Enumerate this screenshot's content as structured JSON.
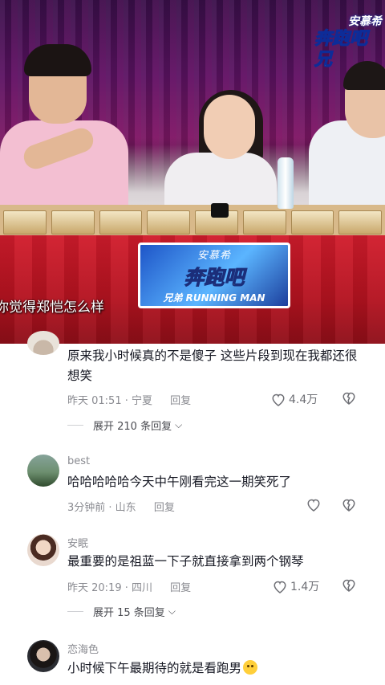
{
  "video": {
    "caption": "你觉得郑恺怎么样",
    "brand_sign": {
      "line1": "安慕希",
      "line2": "奔跑吧",
      "line3": "兄弟 RUNNING MAN"
    },
    "corner_logo": {
      "line1": "安慕希",
      "line2": "奔跑吧兄"
    }
  },
  "comments": [
    {
      "text": "原来我小时候真的不是傻子 这些片段到现在我都还很想笑",
      "time_location": "昨天 01:51 · 宁夏",
      "reply_label": "回复",
      "like_count": "4.4万",
      "expand": {
        "label": "展开 210 条回复"
      }
    },
    {
      "username": "best",
      "text": "哈哈哈哈哈今天中午刚看完这一期笑死了",
      "time_location": "3分钟前 · 山东",
      "reply_label": "回复",
      "like_count": ""
    },
    {
      "username": "安眠",
      "text": "最重要的是祖蓝一下子就直接拿到两个钢琴",
      "time_location": "昨天 20:19 · 四川",
      "reply_label": "回复",
      "like_count": "1.4万",
      "expand": {
        "label": "展开 15 条回复"
      }
    },
    {
      "username": "恋海色",
      "text": "小时候下午最期待的就是看跑男",
      "emoji": "smile-emoji"
    }
  ],
  "colors": {
    "text": "#161823",
    "meta": "#8a8b91",
    "tablecloth": "#b3121f"
  }
}
